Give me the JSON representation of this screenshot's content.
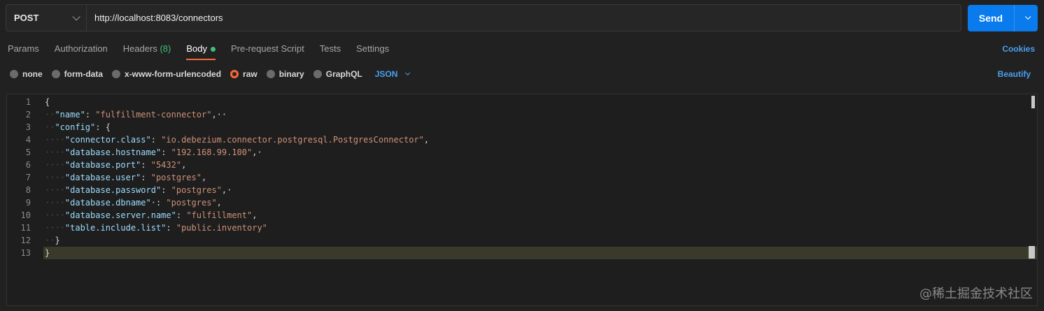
{
  "request": {
    "method": "POST",
    "url": "http://localhost:8083/connectors",
    "send_label": "Send"
  },
  "tabs": [
    {
      "label": "Params"
    },
    {
      "label": "Authorization"
    },
    {
      "label": "Headers",
      "count": "(8)"
    },
    {
      "label": "Body",
      "active": true
    },
    {
      "label": "Pre-request Script"
    },
    {
      "label": "Tests"
    },
    {
      "label": "Settings"
    }
  ],
  "cookies_label": "Cookies",
  "body_modes": [
    {
      "label": "none"
    },
    {
      "label": "form-data"
    },
    {
      "label": "x-www-form-urlencoded"
    },
    {
      "label": "raw",
      "selected": true
    },
    {
      "label": "binary"
    },
    {
      "label": "GraphQL"
    }
  ],
  "language": "JSON",
  "beautify_label": "Beautify",
  "editor": {
    "line_numbers": [
      "1",
      "2",
      "3",
      "4",
      "5",
      "6",
      "7",
      "8",
      "9",
      "10",
      "11",
      "12",
      "13"
    ],
    "lines": [
      {
        "indent": "",
        "key": "",
        "sep": "",
        "value": "",
        "tail": "{"
      },
      {
        "indent": "··",
        "key": "\"name\"",
        "sep": ": ",
        "value": "\"fulfillment-connector\"",
        "tail": ",··"
      },
      {
        "indent": "··",
        "key": "\"config\"",
        "sep": ": ",
        "value": "",
        "tail": "{"
      },
      {
        "indent": "····",
        "key": "\"connector.class\"",
        "sep": ": ",
        "value": "\"io.debezium.connector.postgresql.PostgresConnector\"",
        "tail": ","
      },
      {
        "indent": "····",
        "key": "\"database.hostname\"",
        "sep": ": ",
        "value": "\"192.168.99.100\"",
        "tail": ",·"
      },
      {
        "indent": "····",
        "key": "\"database.port\"",
        "sep": ": ",
        "value": "\"5432\"",
        "tail": ","
      },
      {
        "indent": "····",
        "key": "\"database.user\"",
        "sep": ": ",
        "value": "\"postgres\"",
        "tail": ","
      },
      {
        "indent": "····",
        "key": "\"database.password\"",
        "sep": ": ",
        "value": "\"postgres\"",
        "tail": ",·"
      },
      {
        "indent": "····",
        "key": "\"database.dbname\"",
        "sep": "·: ",
        "value": "\"postgres\"",
        "tail": ","
      },
      {
        "indent": "····",
        "key": "\"database.server.name\"",
        "sep": ": ",
        "value": "\"fulfillment\"",
        "tail": ","
      },
      {
        "indent": "····",
        "key": "\"table.include.list\"",
        "sep": ": ",
        "value": "\"public.inventory\"",
        "tail": ""
      },
      {
        "indent": "··",
        "key": "",
        "sep": "",
        "value": "",
        "tail": "}"
      },
      {
        "indent": "",
        "key": "",
        "sep": "",
        "value": "",
        "tail": "}"
      }
    ]
  },
  "watermark": "@稀土掘金技术社区"
}
